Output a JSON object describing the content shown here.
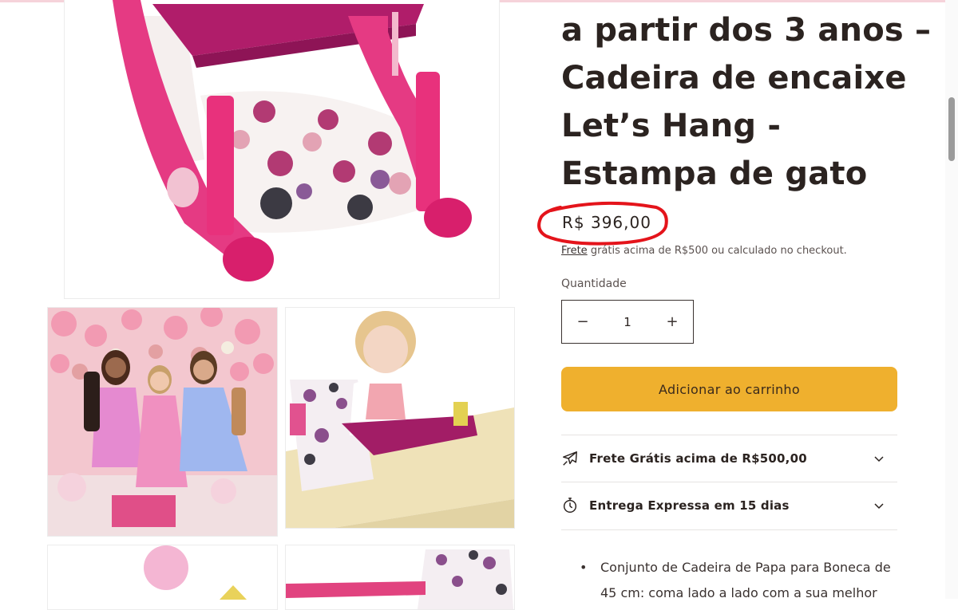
{
  "product": {
    "title_lines": [
      "a partir dos 3 anos –",
      "Cadeira de encaixe",
      "Let’s Hang -",
      "Estampa de gato"
    ],
    "price": "R$ 396,00",
    "shipping_link": "Frete",
    "shipping_text": " grátis acima de R$500 ou calculado no checkout."
  },
  "quantity": {
    "label": "Quantidade",
    "value": "1",
    "decrement_symbol": "−",
    "increment_symbol": "+"
  },
  "cart": {
    "add_label": "Adicionar ao carrinho"
  },
  "accordions": [
    {
      "label": "Frete Grátis acima de R$500,00",
      "icon": "airplane-icon"
    },
    {
      "label": "Entrega Expressa em 15 dias",
      "icon": "stopwatch-icon"
    }
  ],
  "description": {
    "bullets": [
      "Conjunto de Cadeira de Papa para Boneca de 45 cm: coma lado a lado com a sua melhor"
    ]
  },
  "colors": {
    "accent_button": "#efb02e",
    "annotation_circle": "#e4141b",
    "text": "#2b2320"
  }
}
